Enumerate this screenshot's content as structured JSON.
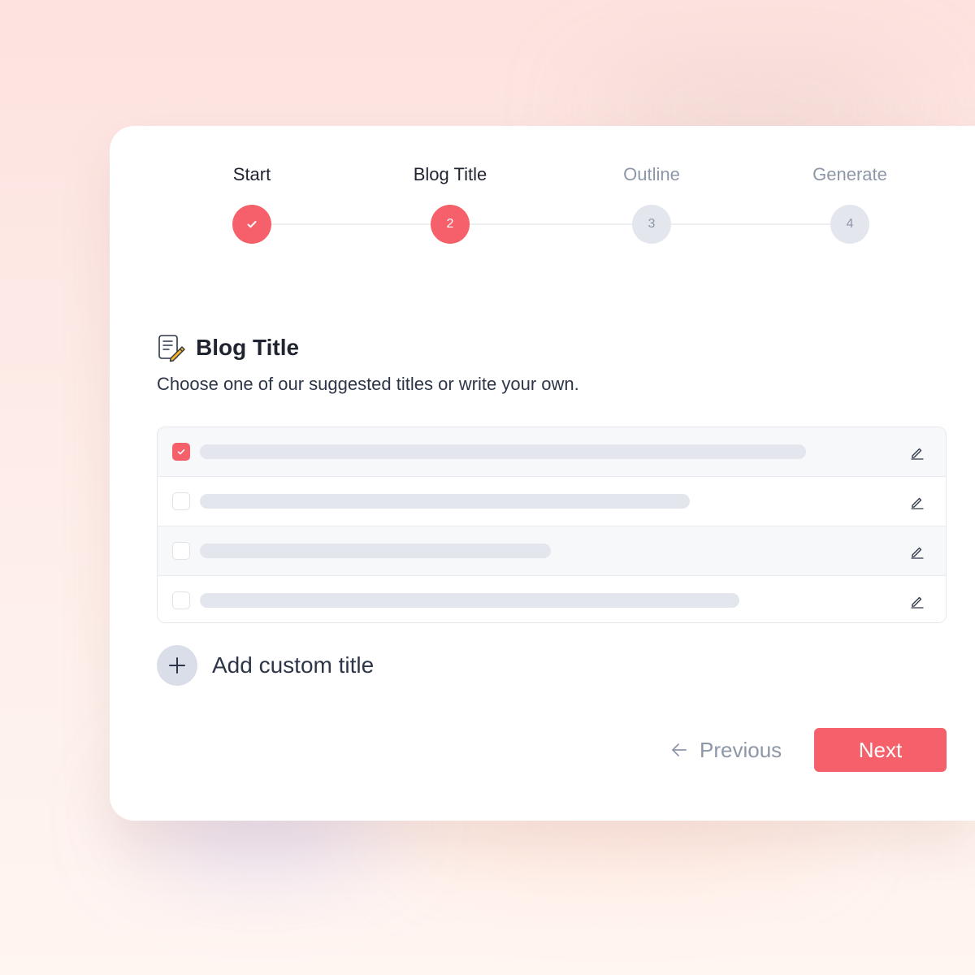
{
  "stepper": {
    "steps": [
      {
        "label": "Start",
        "marker": "",
        "state": "complete",
        "icon": "check-icon"
      },
      {
        "label": "Blog Title",
        "marker": "2",
        "state": "current"
      },
      {
        "label": "Outline",
        "marker": "3",
        "state": "upcoming"
      },
      {
        "label": "Generate",
        "marker": "4",
        "state": "upcoming"
      }
    ]
  },
  "section": {
    "icon": "note-pencil-icon",
    "title": "Blog Title",
    "description": "Choose one of our suggested titles or write your own."
  },
  "title_options": [
    {
      "checked": true,
      "edit_icon": "pencil-icon"
    },
    {
      "checked": false,
      "edit_icon": "pencil-icon"
    },
    {
      "checked": false,
      "edit_icon": "pencil-icon"
    },
    {
      "checked": false,
      "edit_icon": "pencil-icon"
    }
  ],
  "add_custom": {
    "icon": "plus-icon",
    "label": "Add custom title"
  },
  "footer": {
    "previous_label": "Previous",
    "previous_icon": "arrow-left-icon",
    "next_label": "Next"
  },
  "colors": {
    "accent": "#f6606a",
    "muted": "#8e97a8",
    "text": "#1f2430",
    "placeholder": "#e3e6ed"
  }
}
